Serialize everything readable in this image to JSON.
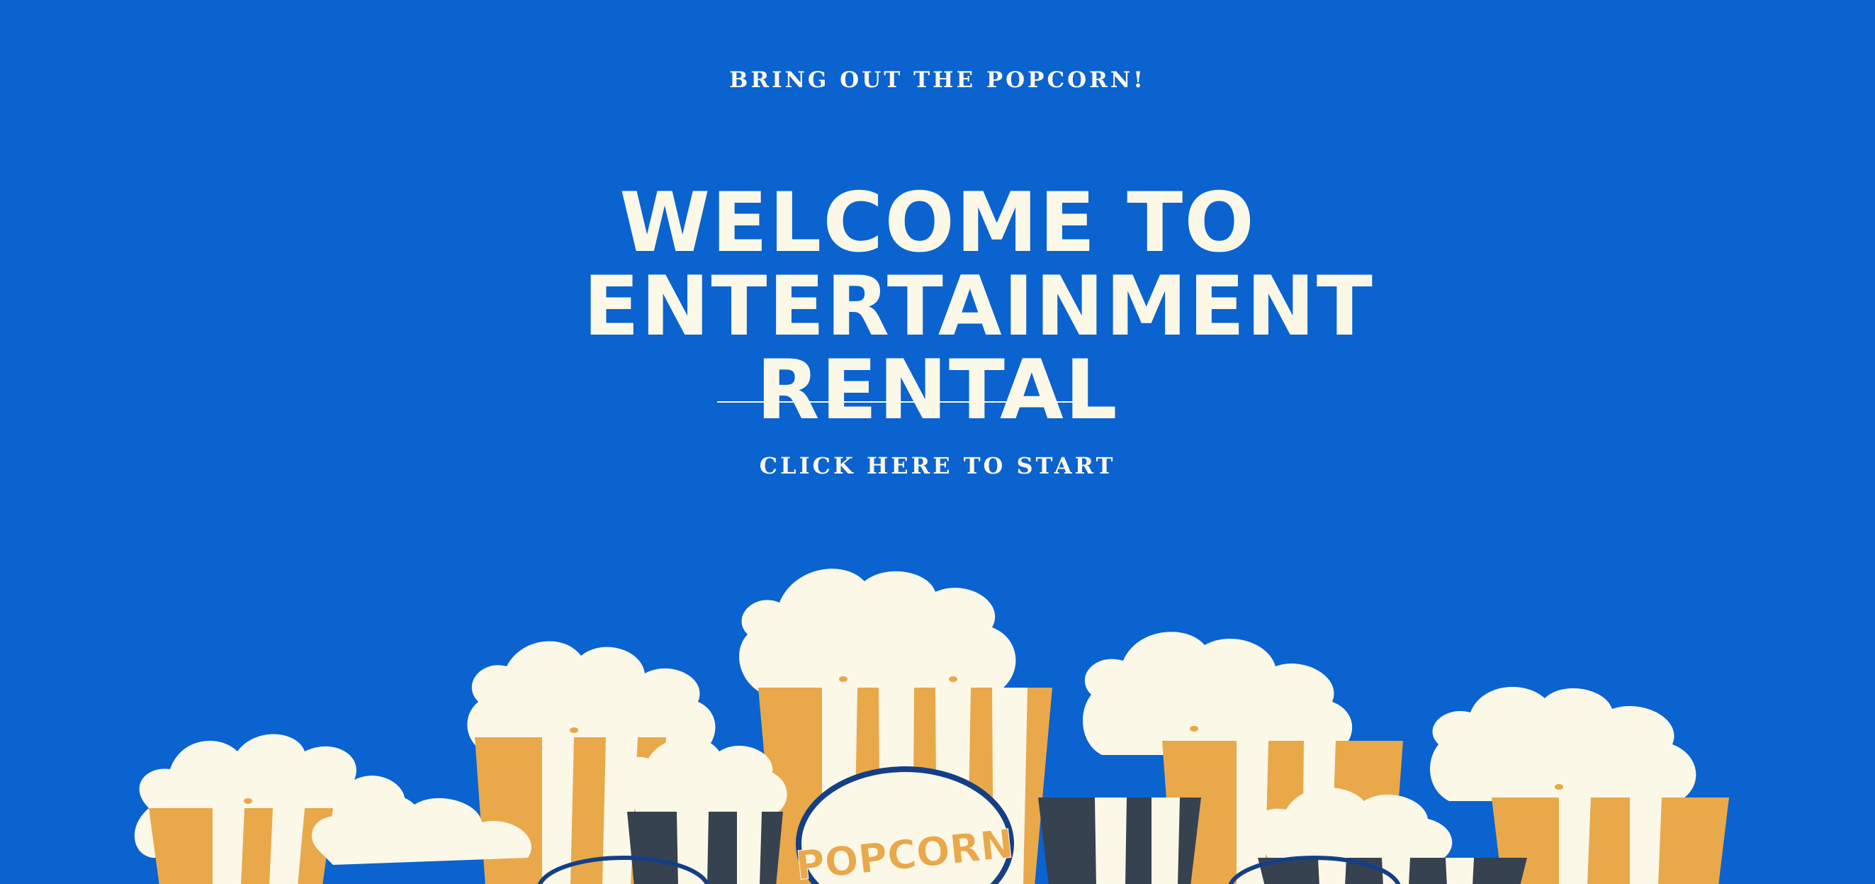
{
  "hero": {
    "eyebrow": "BRING OUT THE POPCORN!",
    "title": "WELCOME TO\nENTERTAINMENT\nRENTAL",
    "cta": "CLICK HERE TO START"
  },
  "art": {
    "bucket_label": "POPCORN"
  },
  "colors": {
    "background": "#0a63cf",
    "cream": "#fbf8e8",
    "mustard": "#e9a84a",
    "slate": "#36424f",
    "navy": "#143f87"
  }
}
